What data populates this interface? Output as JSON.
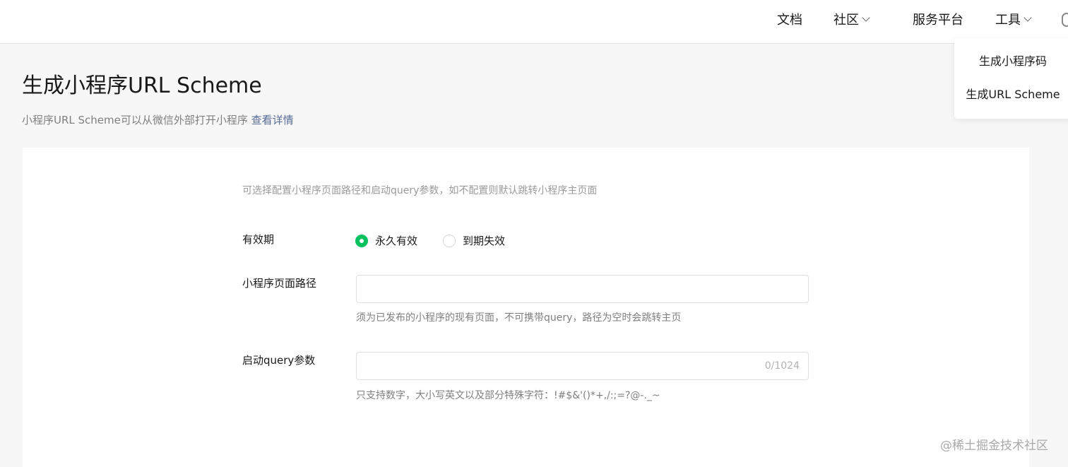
{
  "nav": {
    "docs": "文档",
    "community": "社区",
    "services": "服务平台",
    "tools": "工具"
  },
  "tools_menu": {
    "items": [
      {
        "label": "生成小程序码"
      },
      {
        "label": "生成URL Scheme"
      }
    ]
  },
  "page": {
    "title": "生成小程序URL Scheme",
    "description": "小程序URL Scheme可以从微信外部打开小程序",
    "description_link": "查看详情"
  },
  "form": {
    "hint": "可选择配置小程序页面路径和启动query参数，如不配置则默认跳转小程序主页面",
    "validity": {
      "label": "有效期",
      "options": [
        {
          "label": "永久有效",
          "checked": true
        },
        {
          "label": "到期失效",
          "checked": false
        }
      ]
    },
    "path": {
      "label": "小程序页面路径",
      "value": "",
      "help": "须为已发布的小程序的现有页面，不可携带query，路径为空时会跳转主页"
    },
    "query": {
      "label": "启动query参数",
      "value": "",
      "counter": "0/1024",
      "help": "只支持数字，大小写英文以及部分特殊字符：!#$&'()*+,/:;=?@-._~"
    }
  },
  "watermark": "@稀土掘金技术社区",
  "colors": {
    "accent_green": "#07c160",
    "link_blue": "#576b95"
  }
}
